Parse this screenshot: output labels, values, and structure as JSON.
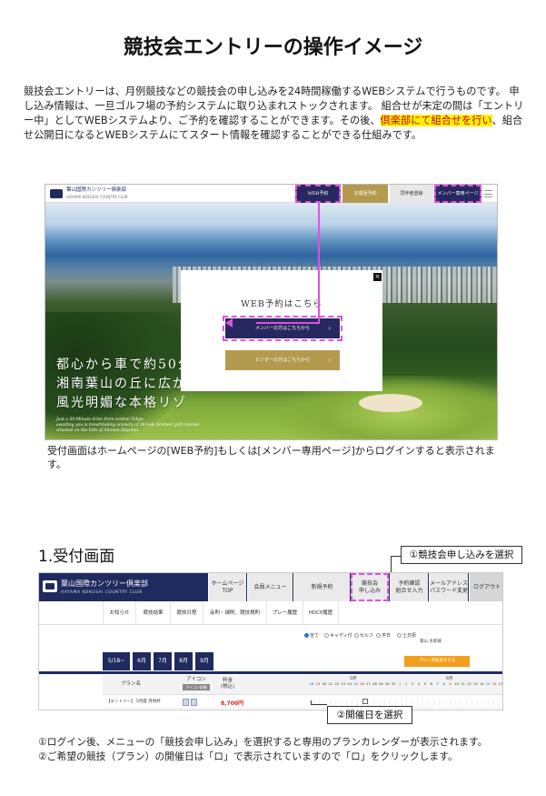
{
  "title": "競技会エントリーの操作イメージ",
  "intro": {
    "p1": "競技会エントリーは、月例競技などの競技会の申し込みを24時間稼働するWEBシステムで行うものです。 申し込み情報は、一旦ゴルフ場の予約システムに取り込まれストックされます。 組合せが未定の間は「エントリー中」としてWEBシステムより、ご予約を確認することができます。その後、",
    "highlight": "倶楽部にて組合せを行い",
    "p2": "、組合せ公開日になるとWEBシステムにてスタート情報を確認することができる仕組みです。"
  },
  "homepage": {
    "logo": "葉山国際カンツリー倶楽部",
    "logo_sub": "HAYAMA KOKUSAI COUNTRY CLUB",
    "nav": [
      "WEB予約",
      "お電話予約",
      "同伴者登録",
      "メンバー専用ページ"
    ],
    "tagline": [
      "都心から車で約50分",
      "湘南葉山の丘に広が",
      "風光明媚な本格リゾ"
    ],
    "tagline_en": [
      "Just a 50-Minute drive from central Tokyo,",
      "awaiting you is breathtaking scenery of 36-hole premier golf courses",
      "situated on the hills of Shonan Hayama"
    ],
    "modal": {
      "title": "WEB予約はこちら",
      "close": "×",
      "member_btn": "メンバーの方はこちらから",
      "visitor_btn": "ビジターの方はこちらから",
      "arrow": "›"
    },
    "colors": {
      "navy": "#27285f",
      "gold": "#b39a4e",
      "highlight": "#e050e0"
    }
  },
  "homepage_caption": "受付画面はホームページの[WEB予約]もしくは[メンバー専用ページ]からログインすると表示されます。",
  "section1": {
    "heading": "1.受付画面",
    "callout_1": "①競技会申し込みを選択",
    "callout_2": "②開催日を選択"
  },
  "reservation": {
    "logo": "葉山国際カンツリー倶楽部",
    "logo_sub": "HAYAMA KOKUSAI COUNTRY CLUB",
    "menu": [
      {
        "l1": "ホームページ",
        "l2": "TOP"
      },
      {
        "l1": "会員メニュー",
        "l2": ""
      },
      {
        "l1": "新規予約",
        "l2": ""
      },
      {
        "l1": "競技会",
        "l2": "申し込み"
      },
      {
        "l1": "予約確認",
        "l2": "組合せ入力"
      },
      {
        "l1": "メールアドレス",
        "l2": "パスワード変更"
      },
      {
        "l1": "ログアウト",
        "l2": ""
      }
    ],
    "tabs": [
      "お知らせ",
      "競技結果",
      "競技日程",
      "会則・細則、競技規則",
      "プレー履歴",
      "HDCP履歴"
    ],
    "filters": [
      "全て",
      "キャディ付",
      "セルフ",
      "平日",
      "土日祝"
    ],
    "note": "葉山 太郎様",
    "orange_btn": "プレー日程表示する",
    "months": [
      "5/18~",
      "6月",
      "7月",
      "8月",
      "9月"
    ],
    "table_head": {
      "plan": "プラン名",
      "icon": "アイコン",
      "icon_sub": "アイコン詳細",
      "fee": "料金",
      "fee_sub": "(税込)",
      "month_may": "5月",
      "month_jun": "6月"
    },
    "days": [
      "18",
      "19",
      "20",
      "21",
      "22",
      "23",
      "24",
      "25",
      "26",
      "27",
      "28",
      "29",
      "30",
      "31",
      "1",
      "2",
      "3",
      "4",
      "5",
      "6",
      "7",
      "8",
      "9",
      "10",
      "11",
      "12",
      "13",
      "14",
      "15",
      "16",
      "17"
    ],
    "row": {
      "plan": "【エントリー】 5月度 月例杯",
      "fee": "8,700円"
    }
  },
  "notes": [
    "①ログイン後、メニューの「競技会申し込み」を選択すると専用のプランカレンダーが表示されます。",
    "②ご希望の競技（プラン）の開催日は「ロ」で表示されていますので「ロ」をクリックします。"
  ]
}
